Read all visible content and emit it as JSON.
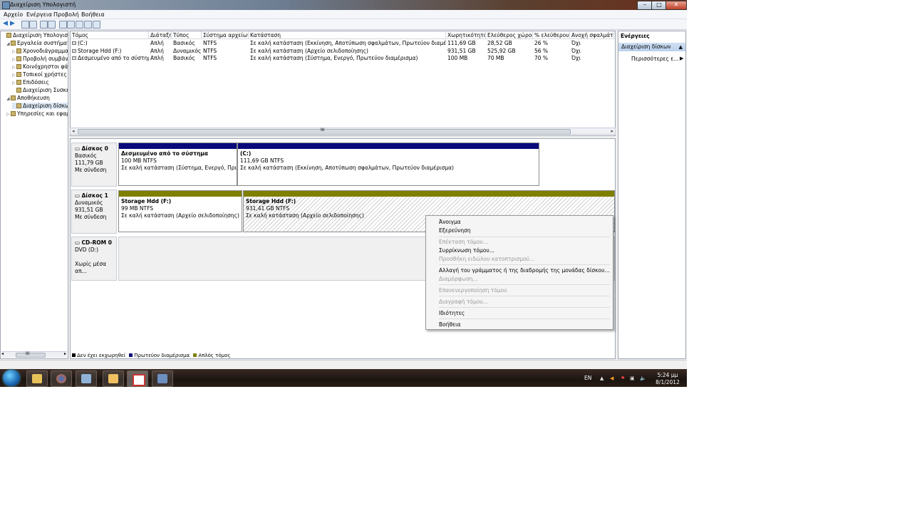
{
  "window": {
    "title": "Διαχείριση Υπολογιστή"
  },
  "menu": [
    "Αρχείο",
    "Ενέργεια",
    "Προβολή",
    "Βοήθεια"
  ],
  "tree": {
    "items": [
      {
        "label": "Διαχείριση Υπολογιστή",
        "level": 0,
        "exp": ""
      },
      {
        "label": "Εργαλεία συστήματος",
        "level": 1,
        "exp": "◢"
      },
      {
        "label": "Χρονοδιάγραμμα",
        "level": 2,
        "exp": "▷"
      },
      {
        "label": "Προβολή συμβάντ",
        "level": 2,
        "exp": "▷"
      },
      {
        "label": "Κοινόχρηστοι φάκ",
        "level": 2,
        "exp": "▷"
      },
      {
        "label": "Τοπικοί χρήστες κ",
        "level": 2,
        "exp": "▷"
      },
      {
        "label": "Επιδόσεις",
        "level": 2,
        "exp": "▷"
      },
      {
        "label": "Διαχείριση Συσκευ",
        "level": 2,
        "exp": ""
      },
      {
        "label": "Αποθήκευση",
        "level": 1,
        "exp": "◢"
      },
      {
        "label": "Διαχείριση δίσκων",
        "level": 2,
        "exp": "",
        "selected": true
      },
      {
        "label": "Υπηρεσίες και εφαρμ",
        "level": 1,
        "exp": "▷"
      }
    ],
    "scroll_label": "III"
  },
  "volume_list": {
    "columns": [
      "Τόμος",
      "Διάταξη",
      "Τύπος",
      "Σύστημα αρχείων",
      "Κατάσταση",
      "Χωρητικότητα",
      "Ελεύθερος χώρος",
      "% ελεύθερου",
      "Ανοχή σφαλμάτ"
    ],
    "rows": [
      [
        "(C:)",
        "Απλή",
        "Βασικός",
        "NTFS",
        "Σε καλή κατάσταση (Εκκίνηση, Αποτύπωση σφαλμάτων, Πρωτεύον διαμέρισμα)",
        "111,69 GB",
        "28,52 GB",
        "26 %",
        "Όχι"
      ],
      [
        "Storage Hdd (F:)",
        "Απλή",
        "Δυναμικός",
        "NTFS",
        "Σε καλή κατάσταση (Αρχείο σελιδοποίησης)",
        "931,51 GB",
        "525,92 GB",
        "56 %",
        "Όχι"
      ],
      [
        "Δεσμευμένο από το σύστημα",
        "Απλή",
        "Βασικός",
        "NTFS",
        "Σε καλή κατάσταση (Σύστημα, Ενεργό, Πρωτεύον διαμέρισμα)",
        "100 MB",
        "70 MB",
        "70 %",
        "Όχι"
      ]
    ],
    "hscroll_label": "III"
  },
  "disks": [
    {
      "name": "Δίσκος 0",
      "type": "Βασικός",
      "size": "111,79 GB",
      "status": "Με σύνδεση",
      "partitions": [
        {
          "name": "Δεσμευμένο από το σύστημα",
          "size": "100 MB NTFS",
          "status": "Σε καλή κατάσταση (Σύστημα, Ενεργό, Πρωτεύ",
          "color": "#0a0a7a"
        },
        {
          "name": "(C:)",
          "size": "111,69 GB NTFS",
          "status": "Σε καλή κατάσταση (Εκκίνηση, Αποτύπωση σφαλμάτων, Πρωτεύον διαμέρισμα)",
          "color": "#0a0a7a"
        }
      ]
    },
    {
      "name": "Δίσκος 1",
      "type": "Δυναμικός",
      "size": "931,51 GB",
      "status": "Με σύνδεση",
      "partitions": [
        {
          "name": "Storage Hdd  (F:)",
          "size": "99 MB NTFS",
          "status": "Σε καλή κατάσταση (Αρχείο σελιδοποίησης)",
          "color": "#7f7f00"
        },
        {
          "name": "Storage Hdd  (F:)",
          "size": "931,41 GB NTFS",
          "status": "Σε καλή κατάσταση (Αρχείο σελιδοποίησης)",
          "color": "#7f7f00"
        }
      ]
    },
    {
      "name": "CD-ROM 0",
      "type": "DVD (D:)",
      "size": "",
      "status": "Χωρίς μέσα απ..."
    }
  ],
  "legend": [
    {
      "label": "Δεν έχει εκχωρηθεί",
      "color": "#000000"
    },
    {
      "label": "Πρωτεύον διαμέρισμα",
      "color": "#0a0a7a"
    },
    {
      "label": "Απλός τόμος",
      "color": "#7f7f00"
    }
  ],
  "actions": {
    "title": "Ενέργειες",
    "section": "Διαχείριση δίσκων",
    "more": "Περισσότερες ε..."
  },
  "context_menu": [
    {
      "label": "Άνοιγμα",
      "disabled": false
    },
    {
      "label": "Εξερεύνηση",
      "disabled": false
    },
    {
      "label": "Επέκταση τόμου...",
      "disabled": true
    },
    {
      "label": "Συρρίκνωση τόμου...",
      "disabled": false
    },
    {
      "label": "Προσθήκη ειδώλου κατοπτρισμού...",
      "disabled": true
    },
    {
      "label": "Αλλαγή  του γράμματος ή της διαδρομής της μονάδας δίσκου...",
      "disabled": false
    },
    {
      "label": "Διαμόρφωση...",
      "disabled": true
    },
    {
      "label": "Επανενεργοποίηση τόμου",
      "disabled": true
    },
    {
      "label": "Διαγραφή τόμου...",
      "disabled": true
    },
    {
      "label": "Ιδιότητες",
      "disabled": false
    },
    {
      "label": "Βοήθεια",
      "disabled": false
    }
  ],
  "tray": {
    "lang": "EN",
    "time": "5:24 μμ",
    "date": "8/1/2012"
  }
}
